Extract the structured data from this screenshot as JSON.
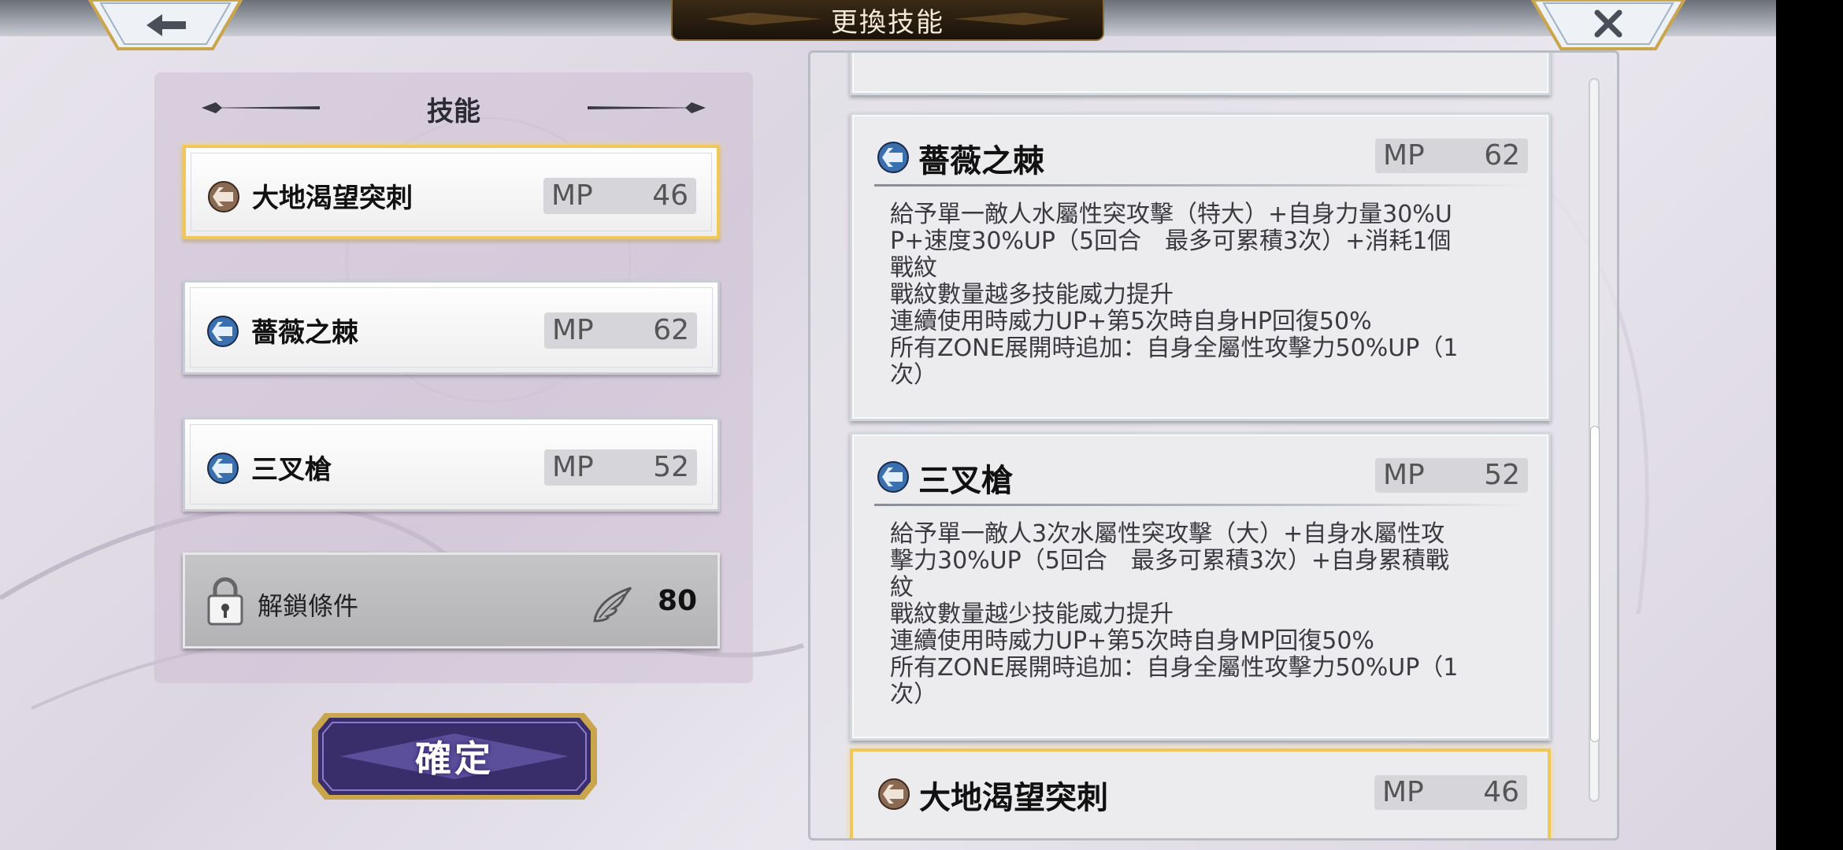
{
  "header": {
    "title": "更換技能",
    "back_icon": "arrow-left-icon",
    "close_icon": "close-icon"
  },
  "left_panel": {
    "title": "技能",
    "skills": [
      {
        "name": "大地渴望突刺",
        "mp_label": "MP",
        "mp": "46",
        "element": "earth",
        "selected": true
      },
      {
        "name": "薔薇之棘",
        "mp_label": "MP",
        "mp": "62",
        "element": "water",
        "selected": false
      },
      {
        "name": "三叉槍",
        "mp_label": "MP",
        "mp": "52",
        "element": "water",
        "selected": false
      }
    ],
    "unlock": {
      "label": "解鎖條件",
      "value": "80",
      "icon": "wing-icon"
    },
    "confirm_label": "確定"
  },
  "detail_panel": {
    "cards": [
      {
        "name": "薔薇之棘",
        "mp_label": "MP",
        "mp": "62",
        "element": "water",
        "description": [
          "給予單一敵人水屬性突攻擊（特大）+自身力量30%U",
          "P+速度30%UP（5回合　最多可累積3次）+消耗1個",
          "戰紋",
          "戰紋數量越多技能威力提升",
          "連續使用時威力UP+第5次時自身HP回復50%",
          "所有ZONE展開時追加：自身全屬性攻擊力50%UP（1",
          "次）"
        ]
      },
      {
        "name": "三叉槍",
        "mp_label": "MP",
        "mp": "52",
        "element": "water",
        "description": [
          "給予單一敵人3次水屬性突攻擊（大）+自身水屬性攻",
          "擊力30%UP（5回合　最多可累積3次）+自身累積戰",
          "紋",
          "戰紋數量越少技能威力提升",
          "連續使用時威力UP+第5次時自身MP回復50%",
          "所有ZONE展開時追加：自身全屬性攻擊力50%UP（1",
          "次）"
        ]
      },
      {
        "name": "大地渴望突刺",
        "mp_label": "MP",
        "mp": "46",
        "element": "earth",
        "description": []
      }
    ]
  },
  "colors": {
    "selected_border": "#f1c75a",
    "water_element": "#3a6fb0",
    "earth_element": "#8a6a52",
    "confirm_button": "#4a3a8a"
  }
}
